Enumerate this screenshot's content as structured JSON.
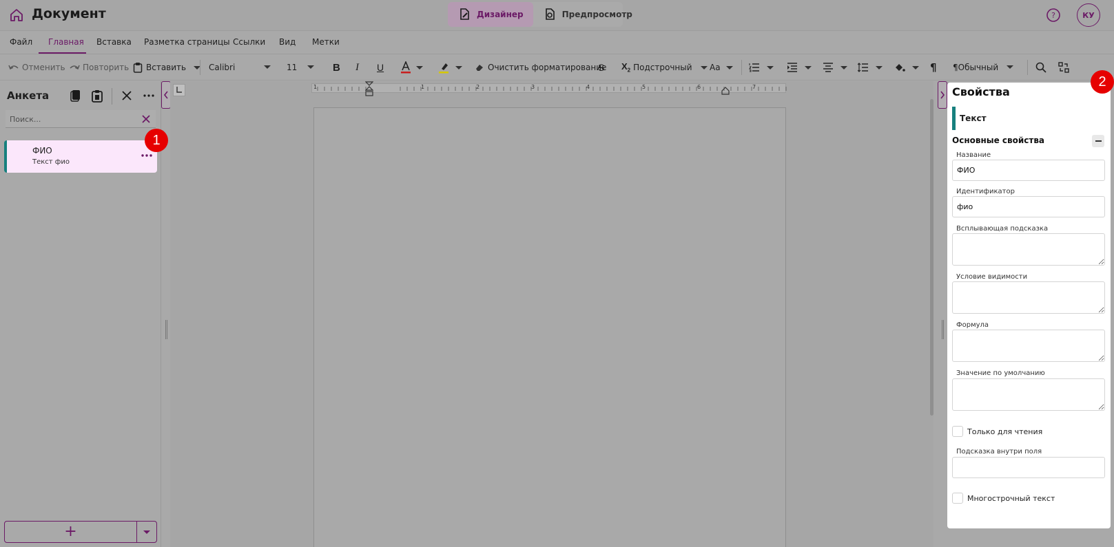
{
  "app": {
    "title": "Документ",
    "modes": [
      {
        "label": "Дизайнер",
        "active": true
      },
      {
        "label": "Предпросмотр",
        "active": false
      }
    ],
    "user_initials": "КУ"
  },
  "menu": {
    "tabs": [
      "Файл",
      "Главная",
      "Вставка",
      "Разметка страницы",
      "Ссылки",
      "Вид",
      "Метки"
    ],
    "active": "Главная"
  },
  "toolbar": {
    "undo": "Отменить",
    "redo": "Повторить",
    "paste": "Вставить",
    "font": "Calibri",
    "size": "11",
    "clear_format": "Очистить форматирование",
    "script": "Подстрочный",
    "case": "Аа",
    "style": "¶Обычный"
  },
  "left_panel": {
    "title": "Анкета",
    "search_placeholder": "Поиск...",
    "fields": [
      {
        "name": "ФИО",
        "description": "Текст фио"
      }
    ],
    "add_symbol": "+"
  },
  "ruler": {
    "numbers": [
      "1",
      "1",
      "2",
      "3",
      "4",
      "5",
      "6",
      "7"
    ]
  },
  "properties": {
    "title": "Свойства",
    "type": "Текст",
    "section": "Основные свойства",
    "fields": {
      "name_label": "Название",
      "name_value": "ФИО",
      "id_label": "Идентификатор",
      "id_value": "фио",
      "tooltip_label": "Всплывающая подсказка",
      "visibility_label": "Условие видимости",
      "formula_label": "Формула",
      "default_label": "Значение по умолчанию",
      "readonly_label": "Только для чтения",
      "placeholder_label": "Подсказка внутри поля",
      "multiline_label": "Многострочный текст"
    }
  },
  "markers": [
    "1",
    "2"
  ],
  "colors": {
    "accent": "#6b1a66",
    "teal": "#17807e",
    "marker": "#e60000"
  }
}
